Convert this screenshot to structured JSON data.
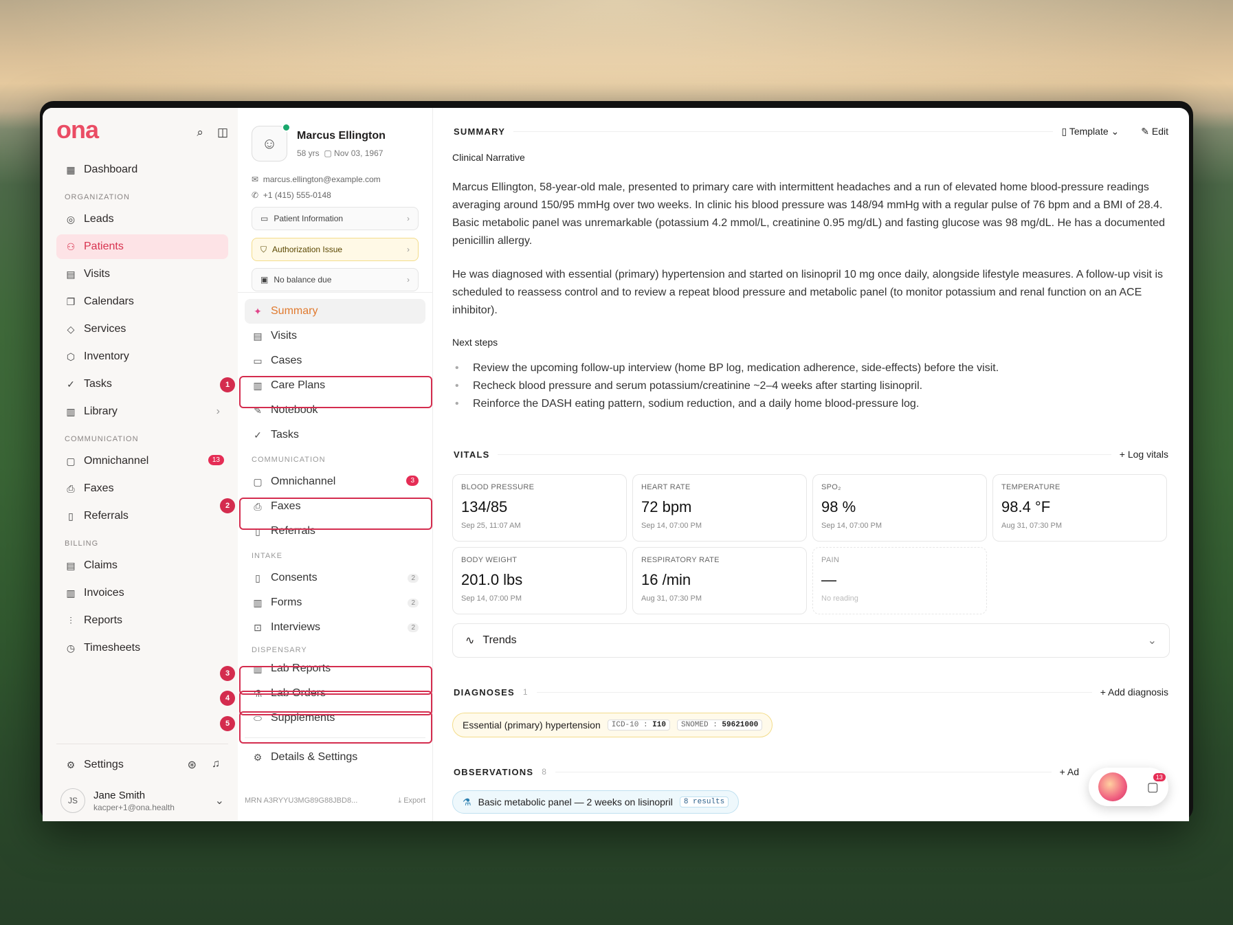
{
  "brand": {
    "logo": "ona"
  },
  "sidebar": {
    "dashboard": "Dashboard",
    "org_label": "ORGANIZATION",
    "org_items": [
      "Leads",
      "Patients",
      "Visits",
      "Calendars",
      "Services",
      "Inventory",
      "Tasks",
      "Library"
    ],
    "comm_label": "COMMUNICATION",
    "comm_items": [
      "Omnichannel",
      "Faxes",
      "Referrals"
    ],
    "omni_badge": "13",
    "billing_label": "BILLING",
    "billing_items": [
      "Claims",
      "Invoices",
      "Reports",
      "Timesheets"
    ],
    "settings": "Settings",
    "user": {
      "initials": "JS",
      "name": "Jane Smith",
      "email": "kacper+1@ona.health"
    }
  },
  "markers": [
    "1",
    "2",
    "3",
    "4",
    "5"
  ],
  "patient": {
    "name": "Marcus Ellington",
    "age": "58 yrs",
    "dob": "Nov 03, 1967",
    "email": "marcus.ellington@example.com",
    "phone": "+1 (415) 555-0148",
    "pill_info": "Patient Information",
    "pill_auth": "Authorization Issue",
    "pill_balance": "No balance due",
    "mrn": "MRN A3RYYU3MG89G88JBD8...",
    "export": "Export"
  },
  "patient_nav": {
    "items": [
      "Summary",
      "Visits",
      "Cases",
      "Care Plans",
      "Notebook",
      "Tasks"
    ],
    "comm_label": "COMMUNICATION",
    "comm": [
      "Omnichannel",
      "Faxes",
      "Referrals"
    ],
    "omni_badge": "3",
    "intake_label": "INTAKE",
    "intake": [
      {
        "label": "Consents",
        "count": "2"
      },
      {
        "label": "Forms",
        "count": "2"
      },
      {
        "label": "Interviews",
        "count": "2"
      }
    ],
    "disp_label": "DISPENSARY",
    "disp": [
      "Lab Reports",
      "Lab Orders",
      "Supplements"
    ],
    "details": "Details & Settings"
  },
  "summary": {
    "title": "SUMMARY",
    "template": "Template",
    "edit": "Edit",
    "narrative_label": "Clinical Narrative",
    "p1": "Marcus Ellington, 58-year-old male, presented to primary care with intermittent headaches and a run of elevated home blood-pressure readings averaging around 150/95 mmHg over two weeks. In clinic his blood pressure was 148/94 mmHg with a regular pulse of 76 bpm and a BMI of 28.4. Basic metabolic panel was unremarkable (potassium 4.2 mmol/L, creatinine 0.95 mg/dL) and fasting glucose was 98 mg/dL. He has a documented penicillin allergy.",
    "p2": "He was diagnosed with essential (primary) hypertension and started on lisinopril 10 mg once daily, alongside lifestyle measures. A follow-up visit is scheduled to reassess control and to review a repeat blood pressure and metabolic panel (to monitor potassium and renal function on an ACE inhibitor).",
    "next_label": "Next steps",
    "next": [
      "Review the upcoming follow-up interview (home BP log, medication adherence, side-effects) before the visit.",
      "Recheck blood pressure and serum potassium/creatinine ~2–4 weeks after starting lisinopril.",
      "Reinforce the DASH eating pattern, sodium reduction, and a daily home blood-pressure log."
    ]
  },
  "vitals": {
    "title": "VITALS",
    "log": "Log vitals",
    "cards": [
      {
        "label": "BLOOD PRESSURE",
        "value": "134/85",
        "time": "Sep 25, 11:07 AM"
      },
      {
        "label": "HEART RATE",
        "value": "72 bpm",
        "time": "Sep 14, 07:00 PM"
      },
      {
        "label": "SPO₂",
        "value": "98 %",
        "time": "Sep 14, 07:00 PM"
      },
      {
        "label": "TEMPERATURE",
        "value": "98.4 °F",
        "time": "Aug 31, 07:30 PM"
      },
      {
        "label": "BODY WEIGHT",
        "value": "201.0 lbs",
        "time": "Sep 14, 07:00 PM"
      },
      {
        "label": "RESPIRATORY RATE",
        "value": "16 /min",
        "time": "Aug 31, 07:30 PM"
      },
      {
        "label": "PAIN",
        "value": "—",
        "time": "No reading"
      }
    ],
    "trends": "Trends"
  },
  "diagnoses": {
    "title": "DIAGNOSES",
    "count": "1",
    "add": "Add diagnosis",
    "item": "Essential (primary) hypertension",
    "icd_k": "ICD-10",
    "icd_v": "I10",
    "snomed_k": "SNOMED",
    "snomed_v": "59621000"
  },
  "observations": {
    "title": "OBSERVATIONS",
    "count": "8",
    "add": "Ad",
    "item": "Basic metabolic panel — 2 weeks on lisinopril",
    "results": "8 results"
  },
  "fab": {
    "badge": "13"
  }
}
